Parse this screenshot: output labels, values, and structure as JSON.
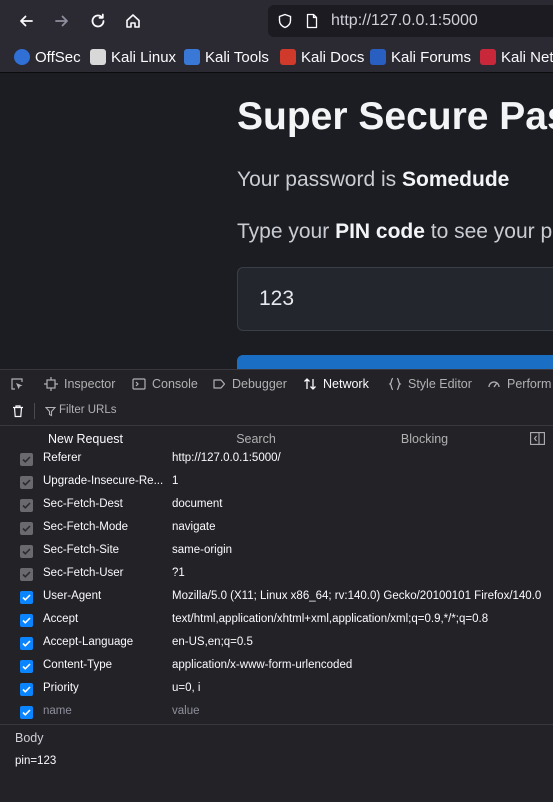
{
  "browser": {
    "url": "http://127.0.0.1:5000",
    "bookmarks": [
      "OffSec",
      "Kali Linux",
      "Kali Tools",
      "Kali Docs",
      "Kali Forums",
      "Kali Net"
    ]
  },
  "page": {
    "title": "Super Secure Pas",
    "password_prefix": "Your password is ",
    "password_value": "Somedude",
    "pin_prefix": "Type your ",
    "pin_bold": "PIN code",
    "pin_suffix": " to see your pas",
    "pin_input_value": "123"
  },
  "devtools": {
    "tabs": [
      "Inspector",
      "Console",
      "Debugger",
      "Network",
      "Style Editor",
      "Perform"
    ],
    "active_tab": "Network",
    "filter_placeholder": "Filter URLs",
    "subtabs": [
      "New Request",
      "Search",
      "Blocking"
    ],
    "headers": [
      {
        "name": "Referer",
        "value": "http://127.0.0.1:5000/",
        "state": "dim"
      },
      {
        "name": "Upgrade-Insecure-Re...",
        "value": "1",
        "state": "dim"
      },
      {
        "name": "Sec-Fetch-Dest",
        "value": "document",
        "state": "dim"
      },
      {
        "name": "Sec-Fetch-Mode",
        "value": "navigate",
        "state": "dim"
      },
      {
        "name": "Sec-Fetch-Site",
        "value": "same-origin",
        "state": "dim"
      },
      {
        "name": "Sec-Fetch-User",
        "value": "?1",
        "state": "dim"
      },
      {
        "name": "User-Agent",
        "value": "Mozilla/5.0 (X11; Linux x86_64; rv:140.0) Gecko/20100101 Firefox/140.0",
        "state": "on"
      },
      {
        "name": "Accept",
        "value": "text/html,application/xhtml+xml,application/xml;q=0.9,*/*;q=0.8",
        "state": "on"
      },
      {
        "name": "Accept-Language",
        "value": "en-US,en;q=0.5",
        "state": "on"
      },
      {
        "name": "Content-Type",
        "value": "application/x-www-form-urlencoded",
        "state": "on"
      },
      {
        "name": "Priority",
        "value": "u=0, i",
        "state": "on"
      },
      {
        "name": "name",
        "value": "value",
        "state": "on"
      }
    ],
    "body_label": "Body",
    "body_value": "pin=123"
  },
  "colors": {
    "accent": "#0a84ff",
    "submit_button": "#1a6fc4"
  }
}
